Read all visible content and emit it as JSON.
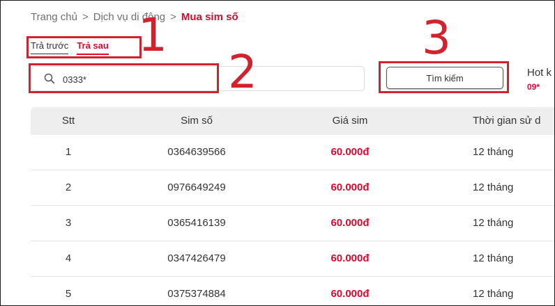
{
  "breadcrumb": {
    "home": "Trang chủ",
    "section": "Dịch vụ di động",
    "current": "Mua sim số",
    "separator": ">"
  },
  "tabs": {
    "prepaid": "Trả trước",
    "postpaid": "Trả sau"
  },
  "search": {
    "value": "0333*",
    "button_label": "Tìm kiếm",
    "icon": "search-icon"
  },
  "hot": {
    "title": "Hot k",
    "code": "09*"
  },
  "annotations": [
    "1",
    "2",
    "3"
  ],
  "table": {
    "columns": [
      "Stt",
      "Sim số",
      "Giá sim",
      "Thời gian sử d"
    ],
    "rows": [
      {
        "stt": "1",
        "sim": "0364639566",
        "price": "60.000đ",
        "time": "12 tháng"
      },
      {
        "stt": "2",
        "sim": "0976649249",
        "price": "60.000đ",
        "time": "12 tháng"
      },
      {
        "stt": "3",
        "sim": "0365416139",
        "price": "60.000đ",
        "time": "12 tháng"
      },
      {
        "stt": "4",
        "sim": "0347426479",
        "price": "60.000đ",
        "time": "12 tháng"
      },
      {
        "stt": "5",
        "sim": "0375374884",
        "price": "60.000đ",
        "time": "12 tháng"
      }
    ]
  },
  "colors": {
    "accent": "#e1062c",
    "annotation": "#d0232e",
    "header_bg": "#eeeeee"
  }
}
